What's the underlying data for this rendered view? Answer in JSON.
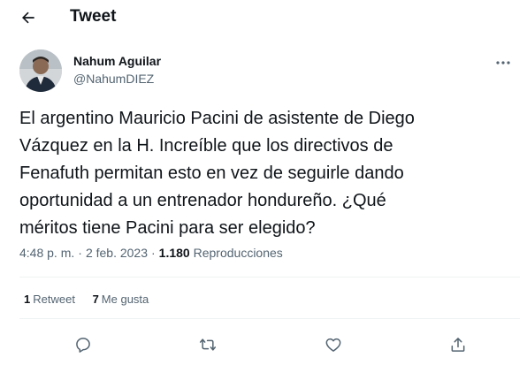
{
  "header": {
    "title": "Tweet",
    "back_icon": "arrow-left-icon"
  },
  "author": {
    "name": "Nahum Aguilar",
    "handle": "@NahumDIEZ",
    "more_icon": "more-horizontal-icon"
  },
  "tweet": {
    "lines": [
      "El argentino Mauricio Pacini de asistente de Diego",
      "Vázquez en la H. Increíble que los directivos de",
      "Fenafuth permitan esto en vez de seguirle dando",
      "oportunidad a un entrenador hondureño. ¿Qué",
      "méritos tiene Pacini para ser elegido?"
    ]
  },
  "meta": {
    "time": "4:48 p. m.",
    "separator": "·",
    "date": "2 feb. 2023",
    "views_count": "1.180",
    "views_label": "Reproducciones"
  },
  "stats": {
    "retweets_count": "1",
    "retweets_label": "Retweet",
    "likes_count": "7",
    "likes_label": "Me gusta"
  },
  "actions": {
    "reply_icon": "reply-icon",
    "retweet_icon": "retweet-icon",
    "like_icon": "heart-icon",
    "share_icon": "share-icon"
  },
  "colors": {
    "text": "#0f1419",
    "secondary": "#536471",
    "divider": "#eff3f4"
  }
}
